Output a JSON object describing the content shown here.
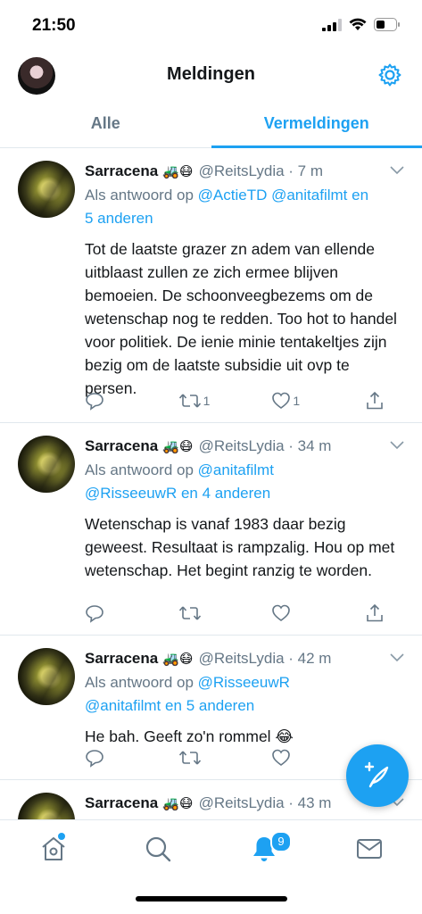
{
  "status": {
    "time": "21:50"
  },
  "header": {
    "title": "Meldingen"
  },
  "tabs": [
    {
      "label": "Alle",
      "active": false
    },
    {
      "label": "Vermeldingen",
      "active": true
    }
  ],
  "colors": {
    "accent": "#1da1f2",
    "text": "#14171a",
    "muted": "#657786"
  },
  "tweets": [
    {
      "name": "Sarracena",
      "emojis": "🚜😷",
      "handle": "@ReitsLydia · 7 m",
      "reply_prefix": "Als antwoord op",
      "reply_links": [
        "@ActieTD",
        "@anitafilmt",
        "en",
        "5 anderen"
      ],
      "text": "Tot de laatste grazer zn adem van ellende uitblaast zullen ze zich ermee blijven bemoeien. De schoonveegbezems om de wetenschap nog te redden. Too hot to handel voor politiek. De ienie minie tentakeltjes zijn bezig om de laatste subsidie uit ovp te persen.",
      "retweets": "1",
      "likes": "1"
    },
    {
      "name": "Sarracena",
      "emojis": "🚜😷",
      "handle": "@ReitsLydia · 34 m",
      "reply_prefix": "Als antwoord op",
      "reply_links": [
        "@anitafilmt",
        "@RisseeuwR",
        "en",
        "4 anderen"
      ],
      "text": "Wetenschap is vanaf 1983 daar bezig geweest. Resultaat is rampzalig.  Hou op met wetenschap. Het begint ranzig te worden.",
      "retweets": "",
      "likes": ""
    },
    {
      "name": "Sarracena",
      "emojis": "🚜😷",
      "handle": "@ReitsLydia · 42 m",
      "reply_prefix": "Als antwoord op",
      "reply_links": [
        "@RisseeuwR",
        "@anitafilmt",
        "en",
        "5 anderen"
      ],
      "text": "He bah. Geeft zo'n rommel 😂",
      "retweets": "",
      "likes": ""
    },
    {
      "name": "Sarracena",
      "emojis": "🚜😷",
      "handle": "@ReitsLydia · 43 m",
      "reply_prefix": "",
      "reply_links": [],
      "text": "",
      "retweets": "",
      "likes": ""
    }
  ],
  "nav": {
    "items": [
      "home-icon",
      "search-icon",
      "notifications-icon",
      "messages-icon"
    ],
    "notification_badge": "9"
  }
}
